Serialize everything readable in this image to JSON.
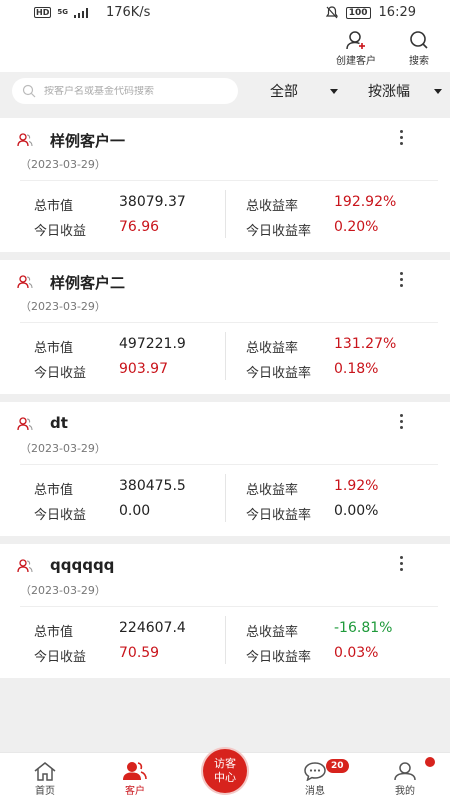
{
  "status_bar": {
    "hd": "HD",
    "net_type": "5G",
    "speed": "176K/s",
    "battery": "100",
    "time": "16:29"
  },
  "header": {
    "create_client_label": "创建客户",
    "search_label": "搜索"
  },
  "filter": {
    "search_placeholder": "按客户名或基金代码搜索",
    "scope_label": "全部",
    "sort_label": "按涨幅"
  },
  "labels": {
    "total_value": "总市值",
    "today_gain": "今日收益",
    "total_return": "总收益率",
    "today_return": "今日收益率"
  },
  "clients": [
    {
      "name": "样例客户一",
      "date": "（2023-03-29）",
      "total_value": "38079.37",
      "today_gain": "76.96",
      "total_return": "192.92%",
      "today_return": "0.20%"
    },
    {
      "name": "样例客户二",
      "date": "（2023-03-29）",
      "total_value": "497221.9",
      "today_gain": "903.97",
      "total_return": "131.27%",
      "today_return": "0.18%"
    },
    {
      "name": "dt",
      "date": "（2023-03-29）",
      "total_value": "380475.5",
      "today_gain": "0.00",
      "total_return": "1.92%",
      "today_return": "0.00%"
    },
    {
      "name": "qqqqqq",
      "date": "（2023-03-29）",
      "total_value": "224607.4",
      "today_gain": "70.59",
      "total_return": "-16.81%",
      "today_return": "0.03%"
    }
  ],
  "tabbar": {
    "home": "首页",
    "clients": "客户",
    "center_line1": "访客",
    "center_line2": "中心",
    "messages": "消息",
    "messages_badge": "20",
    "mine": "我的"
  },
  "colors": {
    "accent": "#d7231d",
    "positive": "#c9141b",
    "negative": "#1f9a3b"
  }
}
